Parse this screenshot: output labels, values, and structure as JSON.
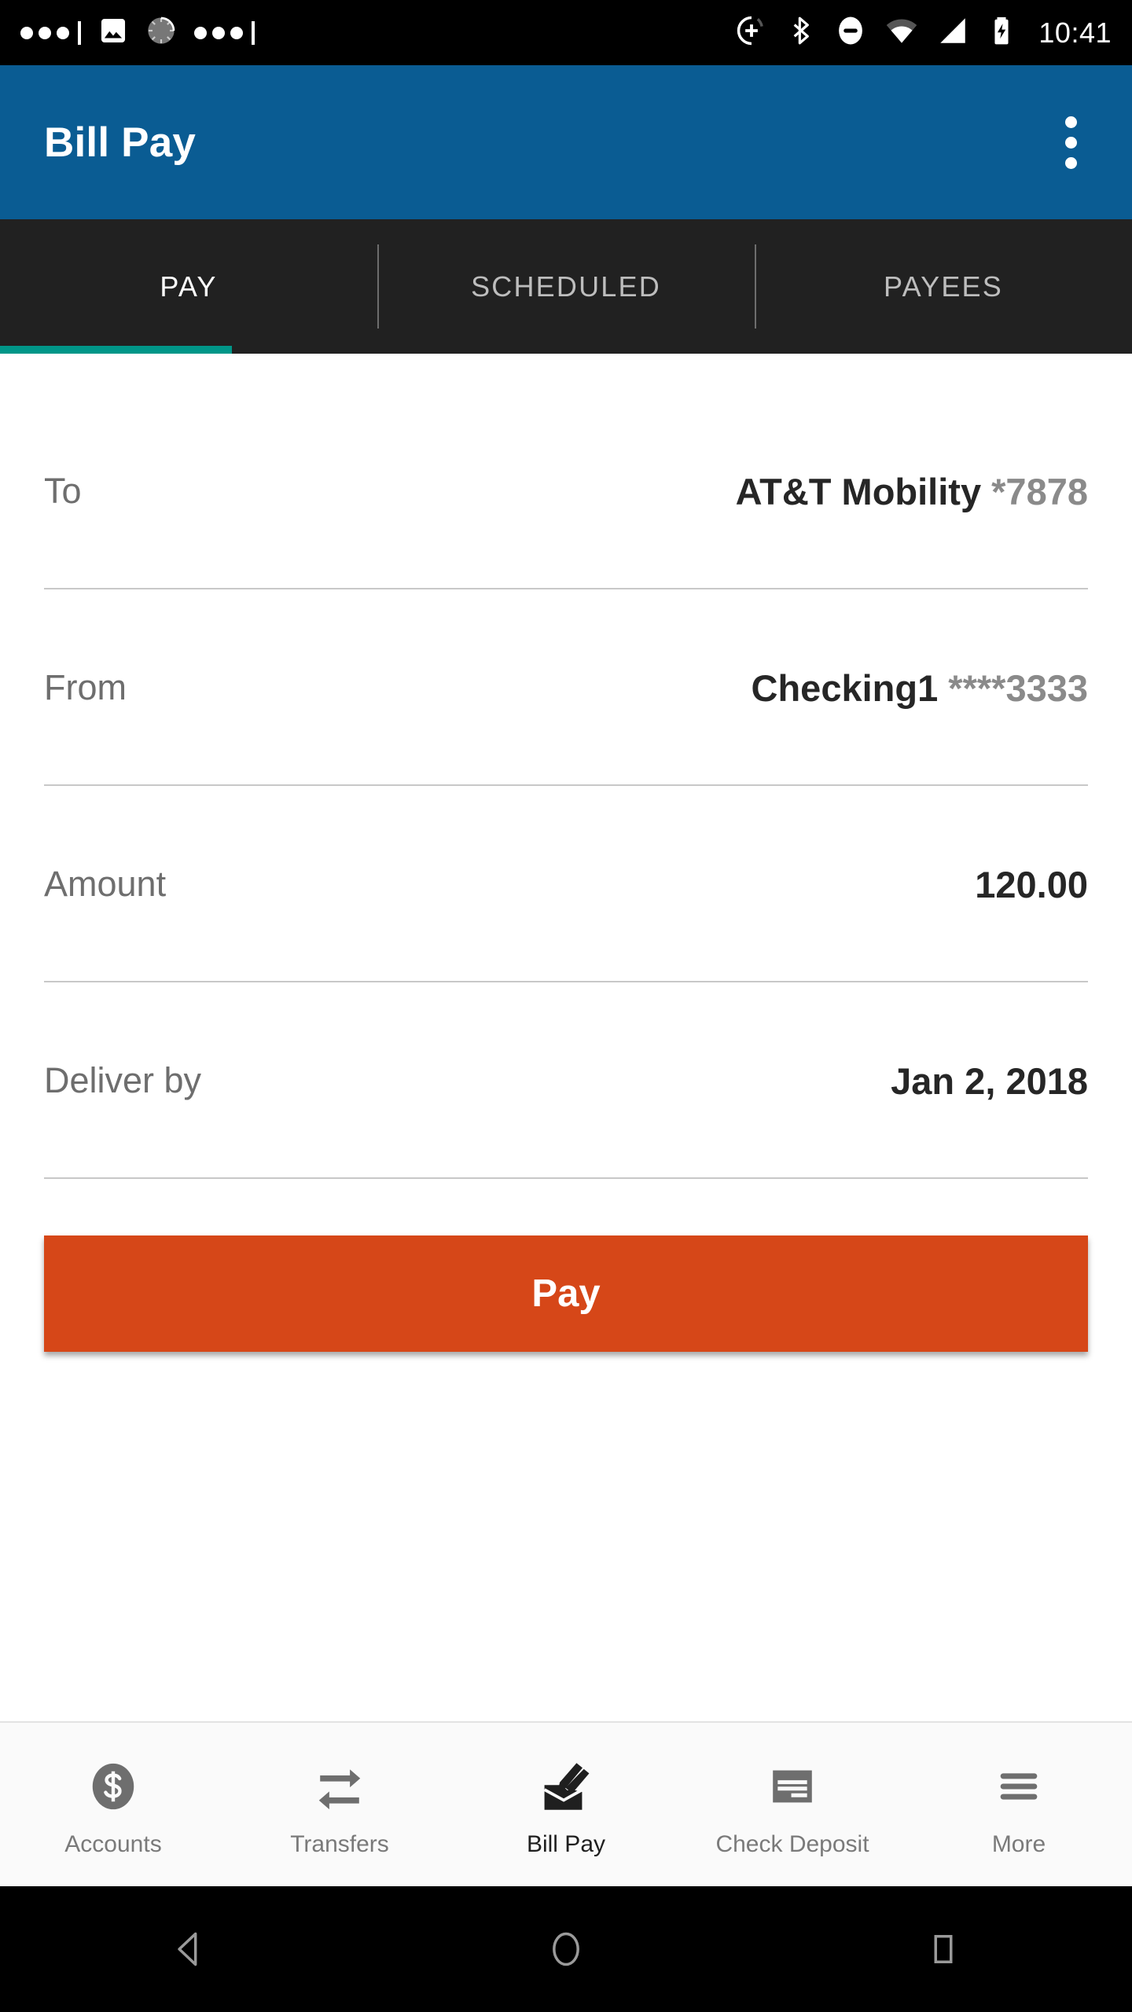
{
  "statusbar": {
    "time": "10:41",
    "left_icons": [
      "dots-indicator",
      "image-icon",
      "loading-spinner-icon",
      "dots-indicator"
    ],
    "right_icons": [
      "add-circle-icon",
      "bluetooth-icon",
      "do-not-disturb-icon",
      "wifi-icon",
      "cellular-signal-icon",
      "battery-charging-icon"
    ]
  },
  "appbar": {
    "title": "Bill Pay",
    "overflow_label": "More options",
    "background": "#0a5c93"
  },
  "tabs": {
    "items": [
      {
        "label": "PAY",
        "active": true
      },
      {
        "label": "SCHEDULED",
        "active": false
      },
      {
        "label": "PAYEES",
        "active": false
      }
    ],
    "indicator_color": "#009688",
    "background": "#212121"
  },
  "form": {
    "rows": [
      {
        "label": "To",
        "value": "AT&T Mobility ",
        "value_muted": "*7878"
      },
      {
        "label": "From",
        "value": "Checking1 ",
        "value_muted": "****3333"
      },
      {
        "label": "Amount",
        "value": "120.00",
        "value_muted": ""
      },
      {
        "label": "Deliver by",
        "value": "Jan 2, 2018",
        "value_muted": ""
      }
    ]
  },
  "pay_button": {
    "label": "Pay",
    "color": "#d64718"
  },
  "bottom_nav": {
    "items": [
      {
        "label": "Accounts",
        "icon": "dollar-circle-icon",
        "active": false
      },
      {
        "label": "Transfers",
        "icon": "transfer-arrows-icon",
        "active": false
      },
      {
        "label": "Bill Pay",
        "icon": "bill-pay-icon",
        "active": true
      },
      {
        "label": "Check Deposit",
        "icon": "check-deposit-icon",
        "active": false
      },
      {
        "label": "More",
        "icon": "hamburger-menu-icon",
        "active": false
      }
    ]
  },
  "android_nav": {
    "back_label": "Back",
    "home_label": "Home",
    "recents_label": "Recent apps"
  }
}
